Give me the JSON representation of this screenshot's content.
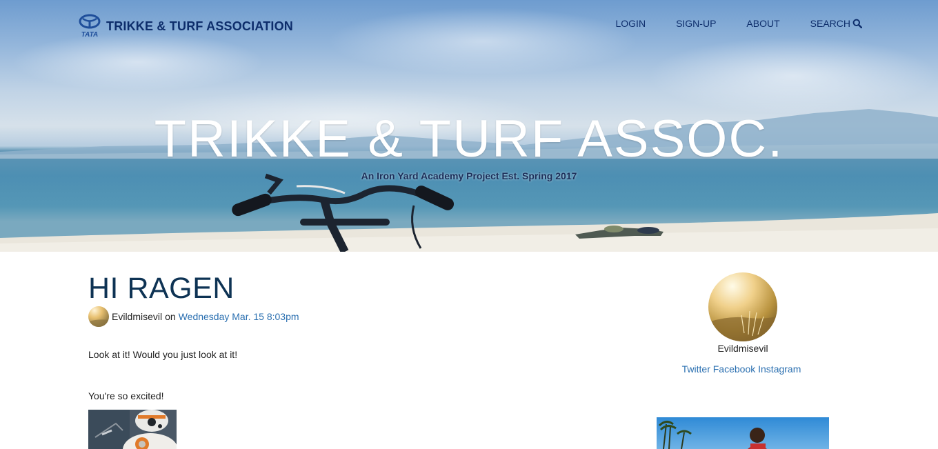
{
  "nav": {
    "logo_text": "TATA",
    "brand": "TRIKKE & TURF ASSOCIATION",
    "links": [
      {
        "label": "LOGIN"
      },
      {
        "label": "SIGN-UP"
      },
      {
        "label": "ABOUT"
      },
      {
        "label": "SEARCH",
        "icon": "search-icon"
      }
    ]
  },
  "hero": {
    "title": "TRIKKE & TURF ASSOC.",
    "subtitle": "An Iron Yard Academy Project Est. Spring 2017"
  },
  "post": {
    "title": "HI RAGEN",
    "author": "Evildmisevil",
    "on": "on",
    "date": "Wednesday Mar. 15 8:03pm",
    "paragraphs": [
      "Look at it! Would you just look at it!",
      "You're so excited!"
    ]
  },
  "sidebar": {
    "name": "Evildmisevil",
    "socials": [
      "Twitter",
      "Facebook",
      "Instagram"
    ]
  },
  "colors": {
    "brand": "#0d2d6b",
    "title": "#0e3354",
    "link": "#2a6fb0"
  }
}
